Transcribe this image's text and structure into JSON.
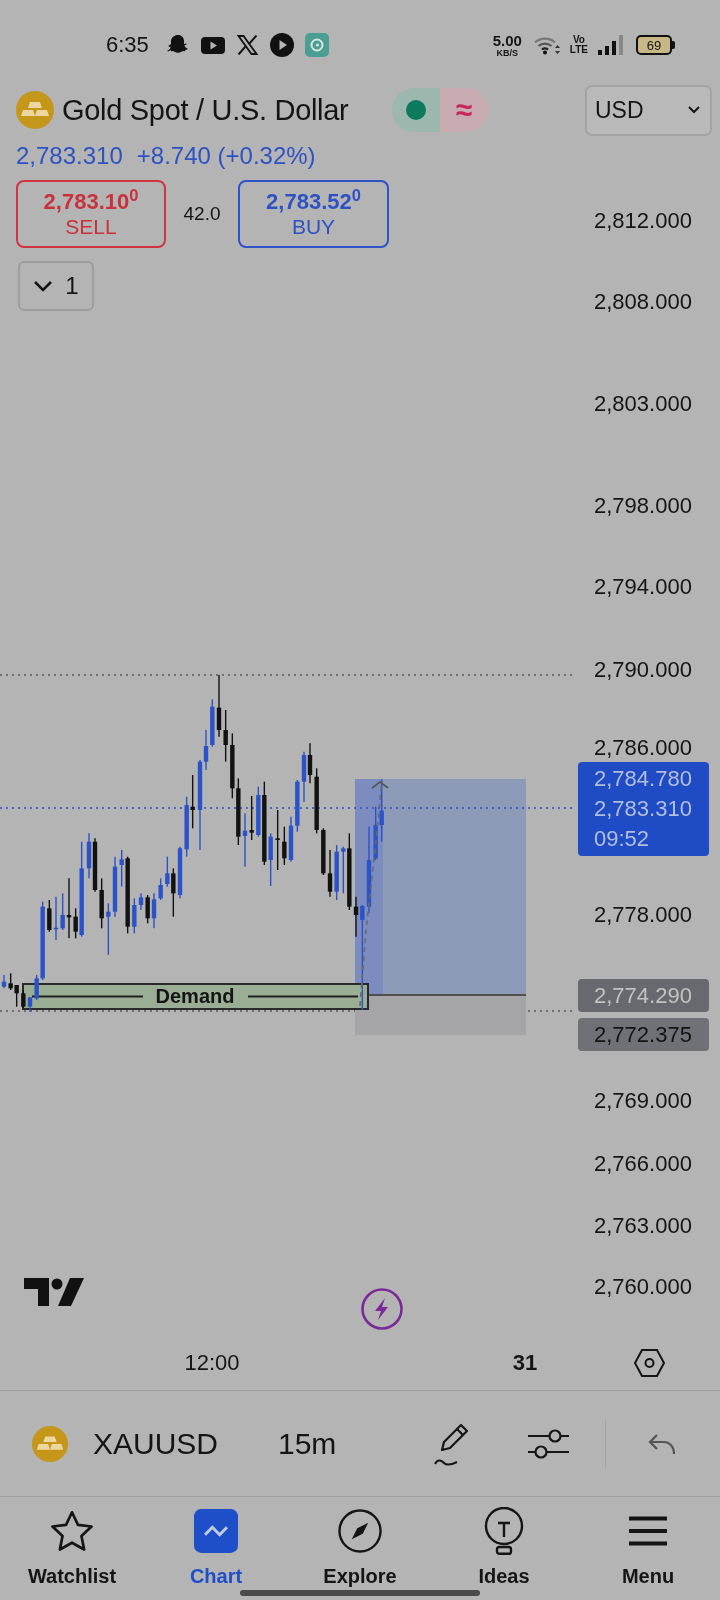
{
  "status_bar": {
    "time": "6:35",
    "net_speed": "5.00",
    "net_unit": "KB/S",
    "network": [
      "Vo",
      "LTE"
    ],
    "battery": "69"
  },
  "header": {
    "title": "Gold Spot / U.S. Dollar",
    "delay_symbol": "≈",
    "currency": "USD",
    "price": "2,783.310",
    "change": "+8.740 (+0.32%)"
  },
  "trade": {
    "sell": {
      "price": "2,783.10$^{0}$",
      "label": "SELL"
    },
    "spread": "42.0",
    "buy": {
      "price": "2,783.52$^{0}$",
      "label": "BUY"
    }
  },
  "indicators": {
    "count": "1"
  },
  "chart": {
    "price_axis": [
      "2,812.000",
      "2,808.000",
      "2,803.000",
      "2,798.000",
      "2,794.000",
      "2,790.000",
      "2,786.000",
      "2,778.000",
      "2,769.000",
      "2,766.000",
      "2,763.000",
      "2,760.000"
    ],
    "price_tags": [
      {
        "kind": "last",
        "lines": [
          "2,784.780",
          "2,783.310",
          "09:52"
        ]
      },
      {
        "kind": "entry",
        "lines": [
          "2,774.290"
        ]
      },
      {
        "kind": "stop",
        "lines": [
          "2,772.375"
        ]
      }
    ],
    "zone_label": "Demand",
    "time_axis": [
      {
        "kind": "time",
        "text": "12:00"
      },
      {
        "kind": "day",
        "text": "31"
      }
    ]
  },
  "toolbar": {
    "symbol": "XAUUSD",
    "interval": "15m"
  },
  "nav": {
    "items": [
      {
        "label": "Watchlist",
        "selected": false
      },
      {
        "label": "Chart",
        "selected": true
      },
      {
        "label": "Explore",
        "selected": false
      },
      {
        "label": "Ideas",
        "selected": false
      },
      {
        "label": "Menu",
        "selected": false
      }
    ]
  }
}
